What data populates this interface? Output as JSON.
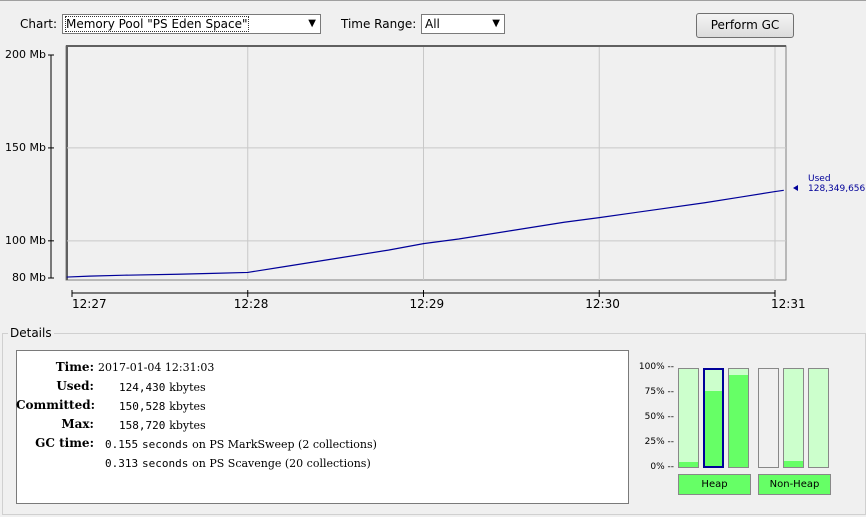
{
  "toolbar": {
    "chart_label": "Chart:",
    "chart_value": "Memory Pool \"PS Eden Space\"",
    "time_range_label": "Time Range:",
    "time_range_value": "All",
    "perform_gc": "Perform GC"
  },
  "chart_data": {
    "type": "line",
    "title": "",
    "xlabel": "",
    "ylabel": "",
    "y_ticks": [
      "200 Mb",
      "150 Mb",
      "100 Mb",
      "80 Mb"
    ],
    "y_tick_values": [
      200,
      150,
      100,
      80
    ],
    "ylim": [
      80,
      200
    ],
    "x_ticks": [
      "12:27",
      "12:28",
      "12:29",
      "12:30",
      "12:31"
    ],
    "x_tick_values": [
      0,
      1,
      2,
      3,
      4
    ],
    "xlim": [
      -0.03,
      4.05
    ],
    "series": [
      {
        "name": "Used",
        "color": "#000099",
        "x": [
          -0.03,
          0.1,
          0.3,
          0.6,
          0.8,
          1.0,
          1.2,
          1.5,
          1.8,
          2.0,
          2.2,
          2.5,
          2.8,
          3.0,
          3.3,
          3.6,
          3.8,
          4.0,
          4.05
        ],
        "y": [
          80.5,
          81,
          81.5,
          82,
          82.5,
          83,
          86,
          90.5,
          95,
          98.5,
          101,
          105.5,
          110,
          112.5,
          116.5,
          120.5,
          123.5,
          126.5,
          127.2
        ]
      }
    ],
    "annotation": {
      "label": "Used",
      "value": "128,349,656"
    }
  },
  "details": {
    "title": "Details",
    "time_label": "Time:",
    "time_value": "2017-01-04 12:31:03",
    "used_label": "Used:",
    "used_num": "124,430",
    "used_unit": "kbytes",
    "committed_label": "Committed:",
    "committed_num": "150,528",
    "committed_unit": "kbytes",
    "max_label": "Max:",
    "max_num": "158,720",
    "max_unit": "kbytes",
    "gc_label": "GC time:",
    "gc": [
      {
        "secs": "0.155",
        "word": "seconds",
        "text": "on PS MarkSweep (2 collections)"
      },
      {
        "secs": "0.313",
        "word": "seconds",
        "text": "on PS Scavenge (20 collections)"
      }
    ]
  },
  "pools": {
    "pct_labels": [
      "100% --",
      "75% --",
      "50% --",
      "25% --",
      "0% --"
    ],
    "heap_label": "Heap",
    "nonheap_label": "Non-Heap",
    "heap": [
      {
        "used": 5,
        "committed": 100
      },
      {
        "used": 78,
        "committed": 100,
        "selected": true
      },
      {
        "used": 94,
        "committed": 100
      }
    ],
    "nonheap": [
      {
        "used": 0,
        "committed": 0
      },
      {
        "used": 6,
        "committed": 100
      },
      {
        "used": 0,
        "committed": 100
      }
    ]
  }
}
